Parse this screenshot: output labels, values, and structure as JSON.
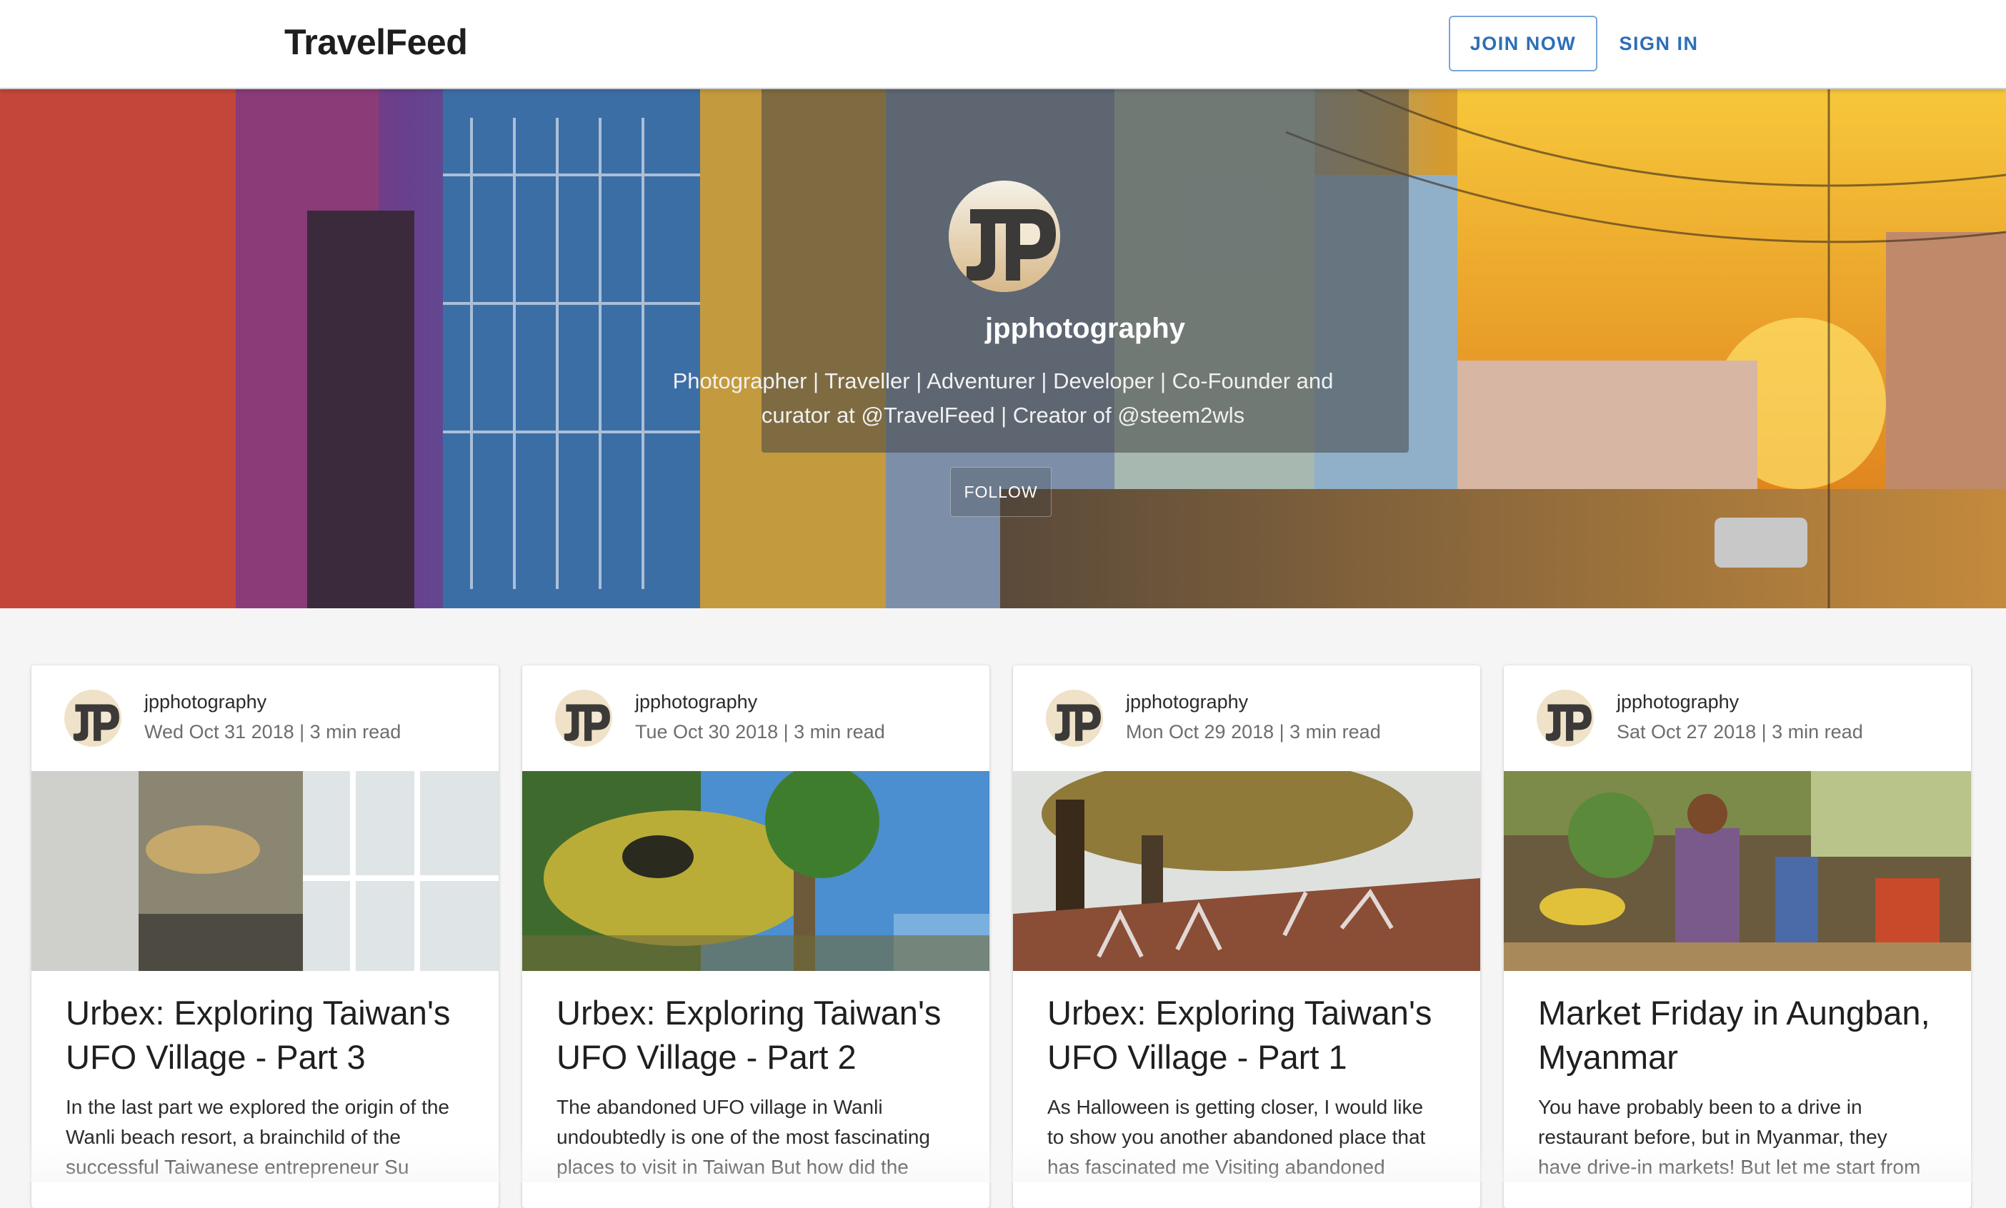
{
  "header": {
    "logo": "TravelFeed",
    "join_label": "JOIN NOW",
    "signin_label": "SIGN IN"
  },
  "profile": {
    "name": "jpphotography",
    "bio_line1": "Photographer | Traveller | Adventurer | Developer | Co-Founder and",
    "bio_line2": "curator at @TravelFeed | Creator of @steem2wls",
    "follow_label": "FOLLOW",
    "avatar_icon": "jp-logo-icon"
  },
  "posts": [
    {
      "author": "jpphotography",
      "meta": "Wed Oct 31 2018 | 3 min read",
      "title_line1": "Urbex: Exploring Taiwan's",
      "title_line2": "UFO Village - Part 3",
      "excerpt_line1": "In the last part we explored the origin of the",
      "excerpt_line2": "Wanli beach resort, a brainchild of the",
      "excerpt_line3": "successful Taiwanese entrepreneur Su"
    },
    {
      "author": "jpphotography",
      "meta": "Tue Oct 30 2018 | 3 min read",
      "title_line1": "Urbex: Exploring Taiwan's",
      "title_line2": "UFO Village - Part 2",
      "excerpt_line1": "The abandoned UFO village in Wanli",
      "excerpt_line2": "undoubtedly is one of the most fascinating",
      "excerpt_line3": "places to visit in Taiwan But how did the"
    },
    {
      "author": "jpphotography",
      "meta": "Mon Oct 29 2018 | 3 min read",
      "title_line1": "Urbex: Exploring Taiwan's",
      "title_line2": "UFO Village - Part 1",
      "excerpt_line1": "As Halloween is getting closer, I would like",
      "excerpt_line2": "to show you another abandoned place that",
      "excerpt_line3": "has fascinated me Visiting abandoned"
    },
    {
      "author": "jpphotography",
      "meta": "Sat Oct 27 2018 | 3 min read",
      "title_line1": "Market Friday in Aungban,",
      "title_line2": "Myanmar",
      "excerpt_line1": "You have probably been to a drive in",
      "excerpt_line2": "restaurant before, but in Myanmar, they",
      "excerpt_line3": "have drive-in markets! But let me start from"
    }
  ],
  "colors": {
    "accent": "#2c6fb7",
    "topbar_bg": "#ffffff",
    "page_bg": "#f5f5f5"
  }
}
